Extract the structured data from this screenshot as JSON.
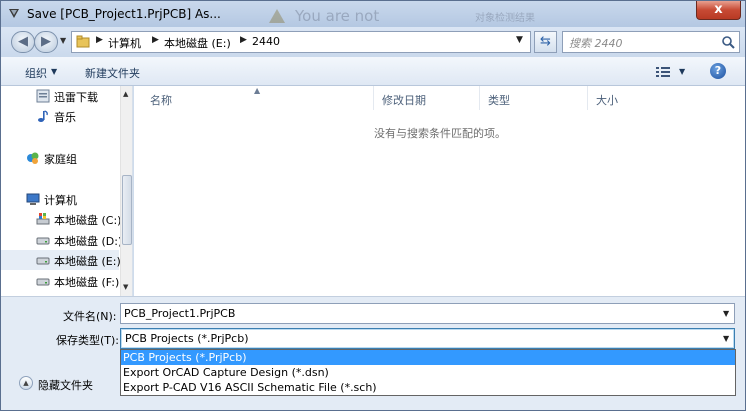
{
  "window": {
    "title": "Save [PCB_Project1.PrjPCB] As...",
    "close_label": "x",
    "background_dialog_text": "You are not",
    "background_dialog_box": "对象检测结果"
  },
  "address_bar": {
    "crumbs": [
      "计算机",
      "本地磁盘 (E:)",
      "2440"
    ]
  },
  "search": {
    "placeholder": "搜索 2440"
  },
  "toolbar": {
    "organize_label": "组织",
    "new_folder_label": "新建文件夹"
  },
  "nav_pane": {
    "items": [
      {
        "label": "迅雷下载",
        "icon": "thunder-download-icon"
      },
      {
        "label": "音乐",
        "icon": "music-icon"
      },
      {
        "label": "家庭组",
        "icon": "homegroup-icon"
      },
      {
        "label": "计算机",
        "icon": "computer-icon"
      },
      {
        "label": "本地磁盘 (C:)",
        "icon": "system-drive-icon"
      },
      {
        "label": "本地磁盘 (D:)",
        "icon": "drive-icon"
      },
      {
        "label": "本地磁盘 (E:)",
        "icon": "drive-icon",
        "selected": true
      },
      {
        "label": "本地磁盘 (F:)",
        "icon": "drive-icon"
      }
    ]
  },
  "file_list": {
    "columns": [
      "名称",
      "修改日期",
      "类型",
      "大小"
    ],
    "empty_message": "没有与搜索条件匹配的项。"
  },
  "form": {
    "filename_label": "文件名(N):",
    "filename_value": "PCB_Project1.PrjPCB",
    "filetype_label": "保存类型(T):",
    "filetype_value": "PCB Projects (*.PrjPcb)",
    "filetype_options": [
      "PCB Projects (*.PrjPcb)",
      "Export OrCAD Capture Design (*.dsn)",
      "Export P-CAD V16 ASCII Schematic File (*.sch)"
    ],
    "hide_folders_label": "隐藏文件夹"
  },
  "colors": {
    "selection": "#3399ff",
    "title_bar": "#b4c8e2",
    "close_button": "#c74a34"
  }
}
